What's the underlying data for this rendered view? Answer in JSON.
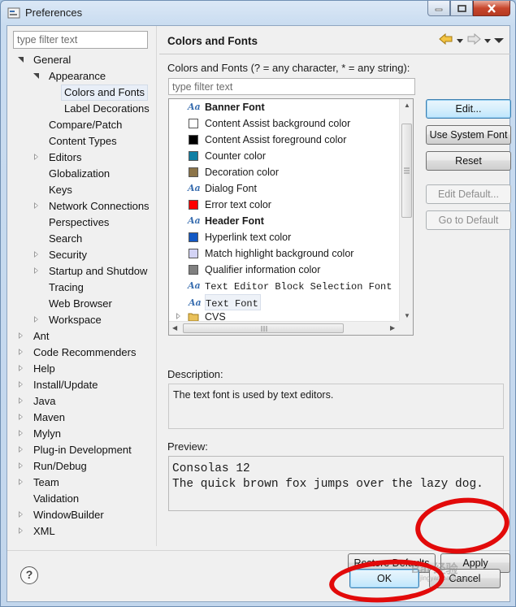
{
  "window": {
    "title": "Preferences"
  },
  "left": {
    "filter_placeholder": "type filter text",
    "tree": [
      {
        "label": "General",
        "level": 0,
        "state": "open"
      },
      {
        "label": "Appearance",
        "level": 1,
        "state": "open"
      },
      {
        "label": "Colors and Fonts",
        "level": 2,
        "state": "leaf",
        "selected": true
      },
      {
        "label": "Label Decorations",
        "level": 2,
        "state": "leaf"
      },
      {
        "label": "Compare/Patch",
        "level": 1,
        "state": "leaf"
      },
      {
        "label": "Content Types",
        "level": 1,
        "state": "leaf"
      },
      {
        "label": "Editors",
        "level": 1,
        "state": "closed"
      },
      {
        "label": "Globalization",
        "level": 1,
        "state": "leaf"
      },
      {
        "label": "Keys",
        "level": 1,
        "state": "leaf"
      },
      {
        "label": "Network Connections",
        "level": 1,
        "state": "closed"
      },
      {
        "label": "Perspectives",
        "level": 1,
        "state": "leaf"
      },
      {
        "label": "Search",
        "level": 1,
        "state": "leaf"
      },
      {
        "label": "Security",
        "level": 1,
        "state": "closed"
      },
      {
        "label": "Startup and Shutdow",
        "level": 1,
        "state": "closed"
      },
      {
        "label": "Tracing",
        "level": 1,
        "state": "leaf"
      },
      {
        "label": "Web Browser",
        "level": 1,
        "state": "leaf"
      },
      {
        "label": "Workspace",
        "level": 1,
        "state": "closed"
      },
      {
        "label": "Ant",
        "level": 0,
        "state": "closed"
      },
      {
        "label": "Code Recommenders",
        "level": 0,
        "state": "closed"
      },
      {
        "label": "Help",
        "level": 0,
        "state": "closed"
      },
      {
        "label": "Install/Update",
        "level": 0,
        "state": "closed"
      },
      {
        "label": "Java",
        "level": 0,
        "state": "closed"
      },
      {
        "label": "Maven",
        "level": 0,
        "state": "closed"
      },
      {
        "label": "Mylyn",
        "level": 0,
        "state": "closed"
      },
      {
        "label": "Plug-in Development",
        "level": 0,
        "state": "closed"
      },
      {
        "label": "Run/Debug",
        "level": 0,
        "state": "closed"
      },
      {
        "label": "Team",
        "level": 0,
        "state": "closed"
      },
      {
        "label": "Validation",
        "level": 0,
        "state": "leaf"
      },
      {
        "label": "WindowBuilder",
        "level": 0,
        "state": "closed"
      },
      {
        "label": "XML",
        "level": 0,
        "state": "closed"
      }
    ]
  },
  "page": {
    "title": "Colors and Fonts",
    "caption": "Colors and Fonts (? = any character, * = any string):",
    "filter_placeholder": "type filter text",
    "items": [
      {
        "label": "Banner Font",
        "kind": "font",
        "bold": true
      },
      {
        "label": "Content Assist background color",
        "kind": "color",
        "color": "#ffffff"
      },
      {
        "label": "Content Assist foreground color",
        "kind": "color",
        "color": "#000000"
      },
      {
        "label": "Counter color",
        "kind": "color",
        "color": "#0f7fa4"
      },
      {
        "label": "Decoration color",
        "kind": "color",
        "color": "#8c7448"
      },
      {
        "label": "Dialog Font",
        "kind": "font"
      },
      {
        "label": "Error text color",
        "kind": "color",
        "color": "#ff0000"
      },
      {
        "label": "Header Font",
        "kind": "font",
        "bold": true
      },
      {
        "label": "Hyperlink text color",
        "kind": "color",
        "color": "#1258c4"
      },
      {
        "label": "Match highlight background color",
        "kind": "color",
        "color": "#d3d3f5"
      },
      {
        "label": "Qualifier information color",
        "kind": "color",
        "color": "#808080"
      },
      {
        "label": "Text Editor Block Selection Font",
        "kind": "font",
        "mono": true
      },
      {
        "label": "Text Font",
        "kind": "font",
        "mono": true,
        "selected": true
      },
      {
        "label": "CVS",
        "kind": "folder"
      }
    ],
    "buttons": {
      "edit": "Edit...",
      "use_system_font": "Use System Font",
      "reset": "Reset",
      "edit_default": "Edit Default...",
      "go_to_default": "Go to Default"
    },
    "description_label": "Description:",
    "description": "The text font is used by text editors.",
    "preview_label": "Preview:",
    "preview": "Consolas 12\nThe quick brown fox jumps over the lazy dog.",
    "restore_defaults": "Restore Defaults",
    "apply": "Apply"
  },
  "dialog": {
    "ok": "OK",
    "cancel": "Cancel"
  },
  "watermark": {
    "line1": "Bai 经验",
    "line2": "jingyan.baidu.com"
  }
}
